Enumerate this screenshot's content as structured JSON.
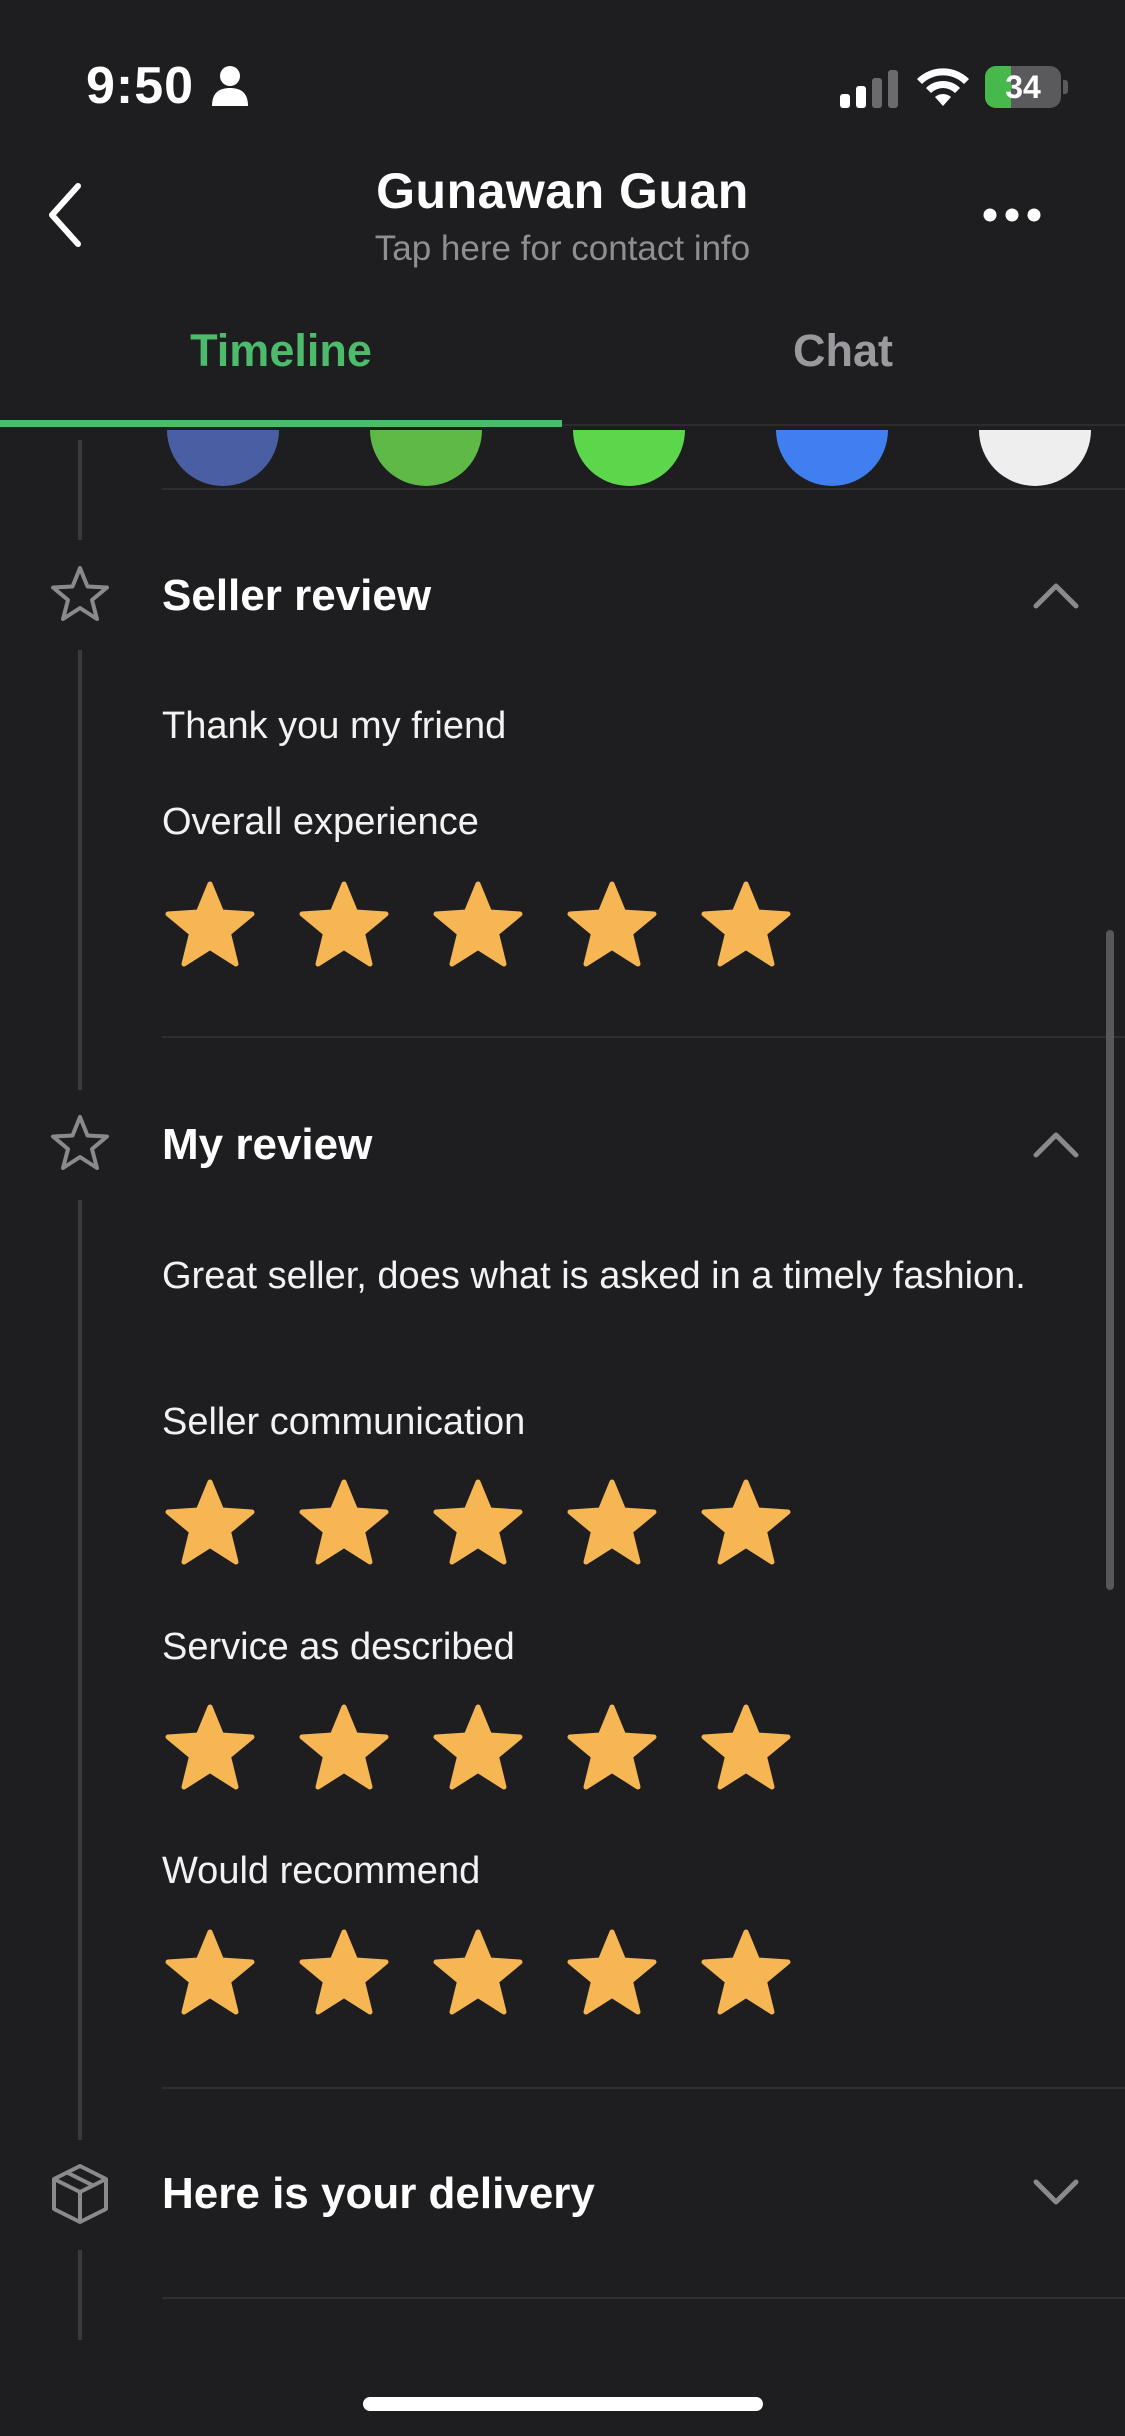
{
  "status_bar": {
    "time": "9:50",
    "battery": "34",
    "battery_level": 0.34,
    "icons": [
      "person-icon",
      "signal-icon",
      "wifi-icon",
      "battery-icon"
    ]
  },
  "header": {
    "name": "Gunawan Guan",
    "subtitle": "Tap here for contact info",
    "icons": [
      "back-chevron-icon",
      "more-options-icon"
    ]
  },
  "tabs": [
    {
      "label": "Timeline",
      "active": true
    },
    {
      "label": "Chat",
      "active": false
    }
  ],
  "colors": {
    "background": "#1e1e20",
    "accent_green": "#4cbb6c",
    "star": "#f6b653",
    "secondary_text": "#8e8e93"
  },
  "avatar_colors": [
    "#4a5fa3",
    "#5fb947",
    "#5cd64a",
    "#3f7ff0",
    "#eeeeee"
  ],
  "seller_review": {
    "title": "Seller review",
    "icon": "star-outline-icon",
    "comment": "Thank you my friend",
    "ratings": [
      {
        "label": "Overall experience",
        "stars": 5
      }
    ]
  },
  "my_review": {
    "title": "My review",
    "icon": "star-outline-icon",
    "comment": "Great seller, does what is asked in a timely fashion.",
    "ratings": [
      {
        "label": "Seller communication",
        "stars": 5
      },
      {
        "label": "Service as described",
        "stars": 5
      },
      {
        "label": "Would recommend",
        "stars": 5
      }
    ]
  },
  "delivery": {
    "title": "Here is your delivery",
    "icon": "package-icon",
    "expanded": false
  }
}
